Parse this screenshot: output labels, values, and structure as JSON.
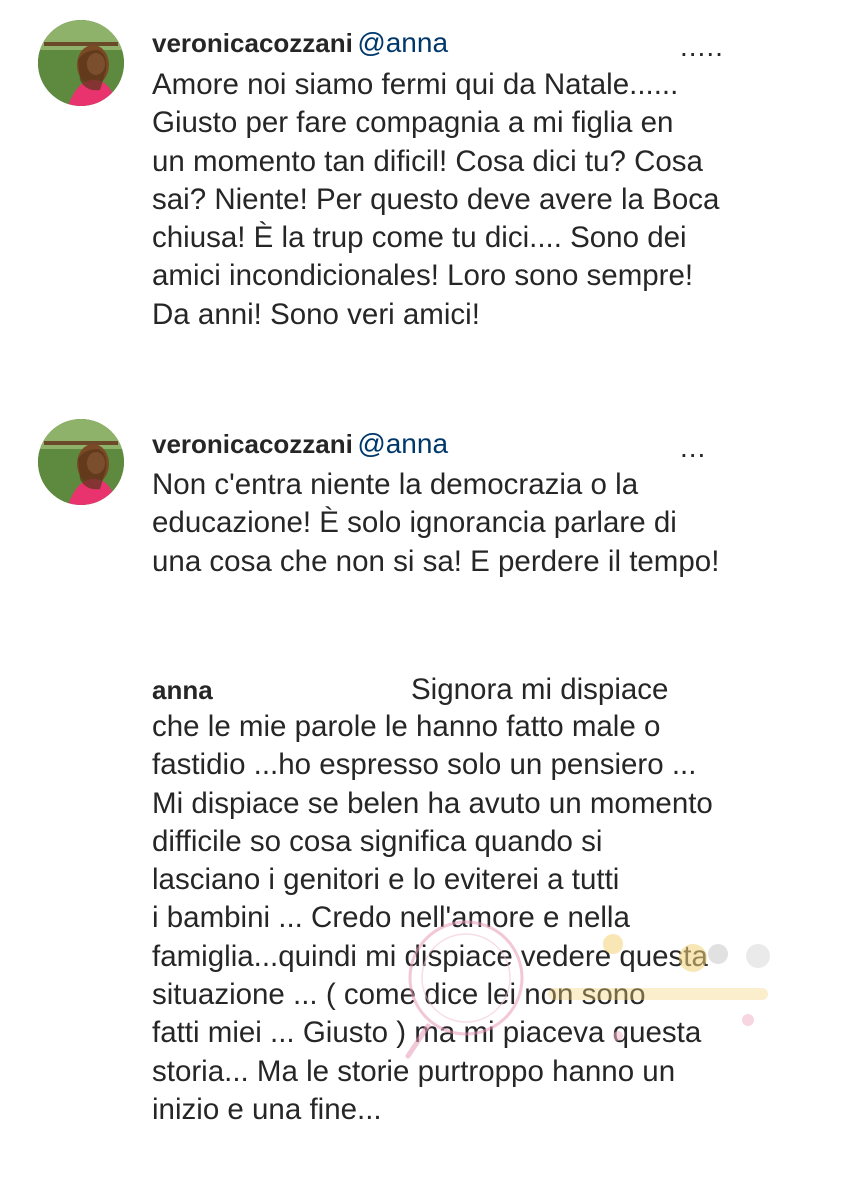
{
  "comments": [
    {
      "username": "veronicacozzani",
      "mention": "@anna",
      "more": ".....",
      "text": "Amore noi siamo fermi qui da Natale......\nGiusto per fare compagnia a mi figlia en\nun momento tan dificil! Cosa dici tu? Cosa\nsai? Niente! Per questo deve avere la Boca\nchiusa! È la trup come tu dici.... Sono dei\namici incondicionales! Loro sono sempre!\nDa anni! Sono veri amici!"
    },
    {
      "username": "veronicacozzani",
      "mention": "@anna",
      "more": "...",
      "text": "Non c'entra niente la democrazia o la\neducazione! È solo ignorancia parlare di\nuna cosa che non si sa! E perdere il tempo!"
    },
    {
      "username": "anna",
      "first_line": "Signora mi dispiace",
      "text": "che le mie parole le hanno fatto male o\nfastidio ...ho espresso solo un pensiero ...\nMi dispiace se belen ha avuto un momento\ndifficile so cosa significa quando si\nlasciano i genitori e lo eviterei a tutti\ni bambini ... Credo nell'amore e nella\nfamiglia...quindi mi dispiace vedere questa\nsituazione ... ( come dice lei non sono\nfatti miei ... Giusto ) ma mi piaceva questa\nstoria... Ma le storie purtroppo hanno un\ninizio e una fine..."
    }
  ],
  "colors": {
    "text": "#262626",
    "mention": "#00376b",
    "background": "#ffffff"
  },
  "icons": {
    "avatar": "profile-photo",
    "watermark": "decorative-watermark"
  }
}
